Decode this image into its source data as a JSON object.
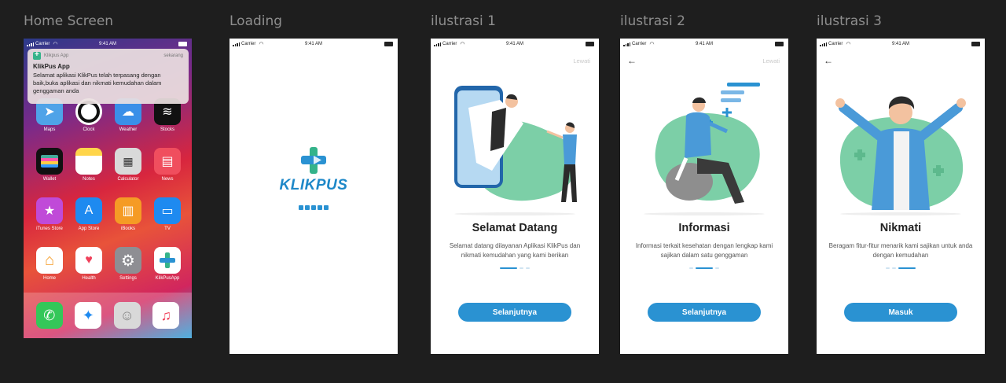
{
  "frames": {
    "home": {
      "label": "Home Screen"
    },
    "loading": {
      "label": "Loading"
    },
    "ilus1": {
      "label": "ilustrasi 1"
    },
    "ilus2": {
      "label": "ilustrasi 2"
    },
    "ilus3": {
      "label": "ilustrasi 3"
    }
  },
  "status": {
    "carrier": "Carrier",
    "time": "9:41 AM"
  },
  "notification": {
    "app_name": "Klikpus App",
    "when": "sekarang",
    "title": "KlikPus App",
    "body": "Selamat aplikasi KlikPus telah terpasang dengan baik,buka aplikasi dan nikmati kemudahan dalam genggaman anda"
  },
  "home_apps": [
    {
      "label": "Maps",
      "icon": "maps-icon",
      "color": "#4fa3e8"
    },
    {
      "label": "Clock",
      "icon": "clock-icon",
      "color": "#111111"
    },
    {
      "label": "Weather",
      "icon": "weather-icon",
      "color": "#3a8fe8"
    },
    {
      "label": "Stocks",
      "icon": "stocks-icon",
      "color": "#111111"
    },
    {
      "label": "Wallet",
      "icon": "wallet-icon",
      "color": "#111111"
    },
    {
      "label": "Notes",
      "icon": "notes-icon",
      "color": "#ffd54a"
    },
    {
      "label": "Calculator",
      "icon": "calculator-icon",
      "color": "#2a2a2a"
    },
    {
      "label": "News",
      "icon": "news-icon",
      "color": "#f04e5e"
    },
    {
      "label": "iTunes Store",
      "icon": "itunes-store-icon",
      "color": "#c04ad8"
    },
    {
      "label": "App Store",
      "icon": "app-store-icon",
      "color": "#1e8af0"
    },
    {
      "label": "iBooks",
      "icon": "ibooks-icon",
      "color": "#f59b25"
    },
    {
      "label": "TV",
      "icon": "tv-icon",
      "color": "#1e8af0"
    },
    {
      "label": "Home",
      "icon": "home-app-icon",
      "color": "#f59b25"
    },
    {
      "label": "Health",
      "icon": "health-icon",
      "color": "#ffffff"
    },
    {
      "label": "Settings",
      "icon": "settings-icon",
      "color": "#8e8e93"
    },
    {
      "label": "KlikPusApp",
      "icon": "klikpus-app-icon",
      "color": "#ffffff"
    }
  ],
  "dock_apps": [
    {
      "icon": "phone-icon",
      "color": "#34c759"
    },
    {
      "icon": "safari-icon",
      "color": "#ffffff"
    },
    {
      "icon": "contacts-icon",
      "color": "#d9d9d9"
    },
    {
      "icon": "music-icon",
      "color": "#ffffff"
    }
  ],
  "loading": {
    "brand": "KLIKPUS"
  },
  "onboarding": [
    {
      "skip": "Lewati",
      "title": "Selamat Datang",
      "desc": "Selamat datang dilayanan Aplikasi KlikPus dan nikmati kemudahan yang kami berikan",
      "cta": "Selanjutnya",
      "page": 0
    },
    {
      "skip": "Lewati",
      "title": "Informasi",
      "desc": "Informasi terkait kesehatan dengan lengkap kami sajikan dalam satu genggaman",
      "cta": "Selanjutnya",
      "page": 1
    },
    {
      "title": "Nikmati",
      "desc": "Beragam fitur-fitur menarik kami sajikan untuk anda dengan kemudahan",
      "cta": "Masuk",
      "page": 2
    }
  ],
  "colors": {
    "accent": "#2a92d2",
    "brand_green": "#34b38a",
    "canvas": "#1e1e1e"
  }
}
